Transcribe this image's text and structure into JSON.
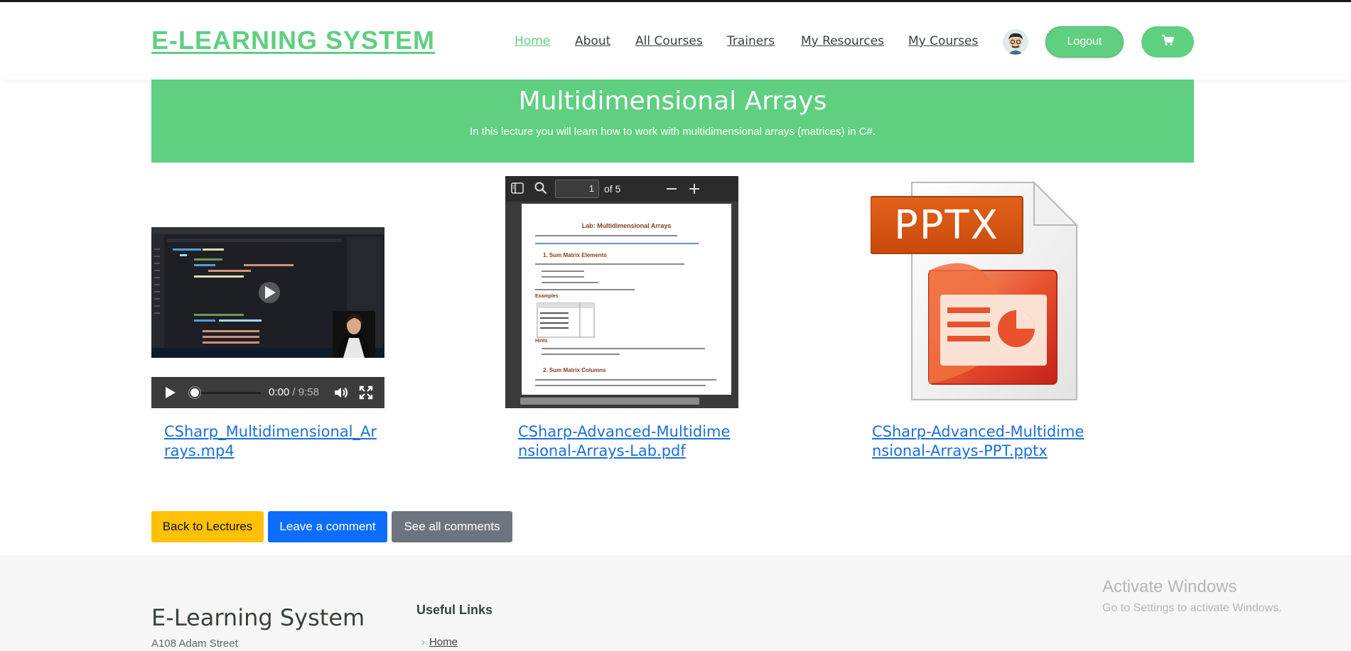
{
  "header": {
    "logo": "E-LEARNING SYSTEM",
    "nav": [
      {
        "label": "Home",
        "active": true
      },
      {
        "label": "About"
      },
      {
        "label": "All Courses"
      },
      {
        "label": "Trainers"
      },
      {
        "label": "My Resources"
      },
      {
        "label": "My Courses"
      }
    ],
    "avatar_icon": "user-avatar",
    "logout_label": "Logout",
    "cart_icon": "shopping-cart-icon"
  },
  "banner": {
    "title": "Multidimensional Arrays",
    "subtitle": "In this lecture you will learn how to work with multidimensional arrays (matrices) in C#."
  },
  "resources": {
    "video": {
      "link": "CSharp_Multidimensional_Arrays.mp4",
      "current_time": "0:00",
      "separator": "/",
      "duration": "9:58"
    },
    "pdf": {
      "link": "CSharp-Advanced-Multidimensional-Arrays-Lab.pdf",
      "page_number": "1",
      "page_count": "of 5",
      "page_title": "Lab: Multidimensional Arrays",
      "heading1": "1. Sum Matrix Elements",
      "examples": "Examples",
      "hints": "Hints",
      "heading2": "2. Sum Matrix Columns"
    },
    "pptx": {
      "link": "CSharp-Advanced-Multidimensional-Arrays-PPT.pptx",
      "badge": "PPTX"
    }
  },
  "actions": {
    "back": "Back to Lectures",
    "comment": "Leave a comment",
    "see_all": "See all comments"
  },
  "footer": {
    "brand": "E-Learning System",
    "address": "A108 Adam Street",
    "useful_links_title": "Useful Links",
    "links": [
      "Home"
    ]
  },
  "watermark": {
    "title": "Activate Windows",
    "subtitle": "Go to Settings to activate Windows."
  },
  "colors": {
    "brand_green": "#5fcf80",
    "back_button": "#ffc107",
    "comment_button": "#0d6efd",
    "see_all_button": "#6c757d",
    "link": "#1a6fd8"
  }
}
